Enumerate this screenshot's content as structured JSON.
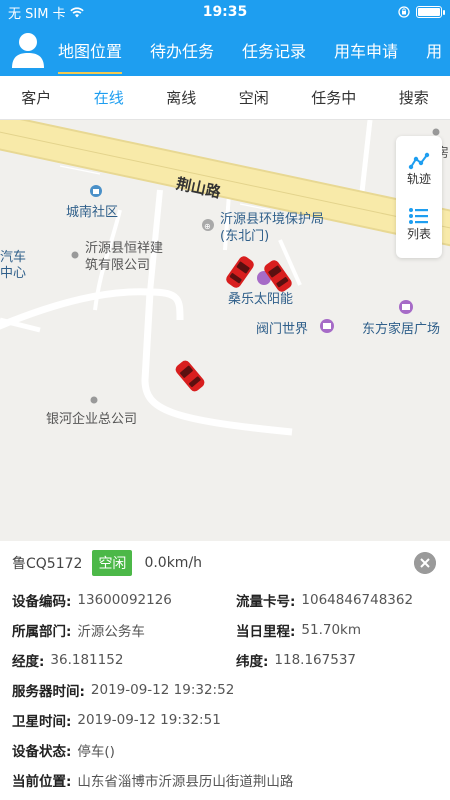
{
  "status_bar": {
    "carrier": "无 SIM 卡",
    "time": "19:35"
  },
  "nav": {
    "tabs": [
      {
        "label": "地图位置",
        "active": true
      },
      {
        "label": "待办任务"
      },
      {
        "label": "任务记录"
      },
      {
        "label": "用车申请"
      },
      {
        "label": "用"
      }
    ]
  },
  "filter_tabs": [
    {
      "label": "客户"
    },
    {
      "label": "在线",
      "active": true
    },
    {
      "label": "离线"
    },
    {
      "label": "空闲"
    },
    {
      "label": "任务中"
    },
    {
      "label": "搜索"
    }
  ],
  "map": {
    "road_label": "荆山路",
    "poi": [
      {
        "label": "城南社区"
      },
      {
        "label": "沂源县环境保护局(东北门)"
      },
      {
        "label": "沂源县恒祥建筑有限公司"
      },
      {
        "label": "桑乐太阳能"
      },
      {
        "label": "阀门世界"
      },
      {
        "label": "东方家居广场"
      },
      {
        "label": "银河企业总公司"
      },
      {
        "label": "汽车中心"
      },
      {
        "label": "房"
      }
    ],
    "side_buttons": [
      {
        "label": "轨迹",
        "icon": "track-icon"
      },
      {
        "label": "列表",
        "icon": "list-icon"
      }
    ]
  },
  "vehicle_info": {
    "plate": "鲁CQ5172",
    "status_badge": "空闲",
    "speed": "0.0km/h",
    "fields": {
      "device_code_label": "设备编码:",
      "device_code": "13600092126",
      "sim_label": "流量卡号:",
      "sim": "1064846748362",
      "dept_label": "所属部门:",
      "dept": "沂源公务车",
      "mileage_label": "当日里程:",
      "mileage": "51.70km",
      "lng_label": "经度:",
      "lng": "36.181152",
      "lat_label": "纬度:",
      "lat": "118.167537",
      "server_time_label": "服务器时间:",
      "server_time": "2019-09-12 19:32:52",
      "sat_time_label": "卫星时间:",
      "sat_time": "2019-09-12 19:32:51",
      "device_status_label": "设备状态:",
      "device_status": "停车()",
      "location_label": "当前位置:",
      "location": "山东省淄博市沂源县历山街道荆山路"
    }
  },
  "colors": {
    "primary": "#1e9ef0",
    "badge_green": "#4cb848",
    "road_yellow": "#f7e9a8",
    "car_red": "#d81e1e"
  }
}
